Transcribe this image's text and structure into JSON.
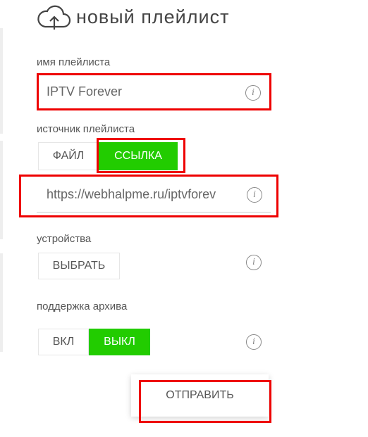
{
  "header": {
    "title": "новый плейлист",
    "icon": "cloud-upload-icon"
  },
  "playlist_name": {
    "label": "имя плейлиста",
    "value": "IPTV Forever"
  },
  "playlist_source": {
    "label": "источник плейлиста",
    "options": [
      "ФАЙЛ",
      "ССЫЛКА"
    ],
    "selected": "ССЫЛКА",
    "url_value": "https://webhalpme.ru/iptvforev"
  },
  "devices": {
    "label": "устройства",
    "button_label": "ВЫБРАТЬ"
  },
  "archive": {
    "label": "поддержка архива",
    "options": [
      "ВКЛ",
      "ВЫКЛ"
    ],
    "selected": "ВЫКЛ"
  },
  "submit_label": "ОТПРАВИТЬ",
  "colors": {
    "accent": "#22cc00",
    "highlight": "#ee0000"
  }
}
